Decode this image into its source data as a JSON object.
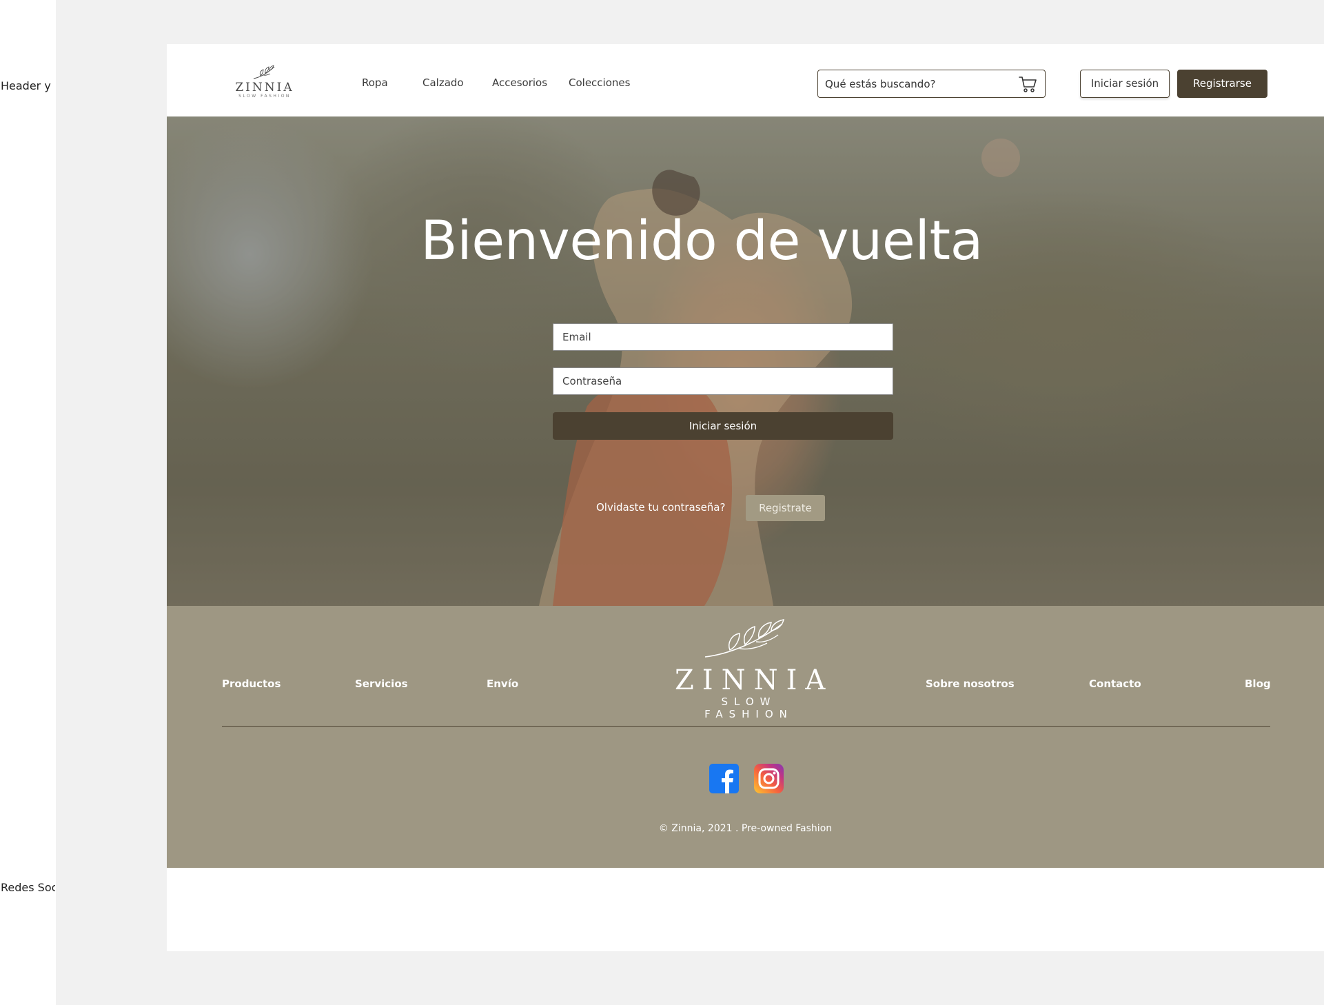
{
  "annotations": {
    "header_label": "Header y",
    "social_label": "Redes Soc"
  },
  "header": {
    "logo": {
      "name": "ZINNIA",
      "tagline": "SLOW FASHION"
    },
    "nav": [
      {
        "label": "Ropa"
      },
      {
        "label": "Calzado"
      },
      {
        "label": "Accesorios"
      },
      {
        "label": "Colecciones"
      }
    ],
    "search": {
      "placeholder": "Qué estás buscando?",
      "icon": "cart-icon"
    },
    "login_label": "Iniciar sesión",
    "register_label": "Registrarse"
  },
  "hero": {
    "title": "Bienvenido de vuelta",
    "email_placeholder": "Email",
    "password_placeholder": "Contraseña",
    "submit_label": "Iniciar sesión",
    "forgot_label": "Olvidaste tu contraseña?",
    "registrate_label": "Registrate"
  },
  "footer": {
    "links_left": [
      {
        "label": "Productos"
      },
      {
        "label": "Servicios"
      },
      {
        "label": "Envío"
      }
    ],
    "links_right": [
      {
        "label": "Sobre nosotros"
      },
      {
        "label": "Contacto"
      },
      {
        "label": "Blog"
      }
    ],
    "logo": {
      "name": "ZINNIA",
      "tagline": "SLOW FASHION"
    },
    "social": [
      {
        "icon": "facebook-icon"
      },
      {
        "icon": "instagram-icon"
      }
    ],
    "copyright": "©  Zinnia, 2021 . Pre-owned Fashion"
  },
  "colors": {
    "brand_dark": "#4b4131",
    "footer_bg": "#9e9783",
    "canvas_bg": "#f1f1f1",
    "registrate_bg": "#a29a83"
  }
}
